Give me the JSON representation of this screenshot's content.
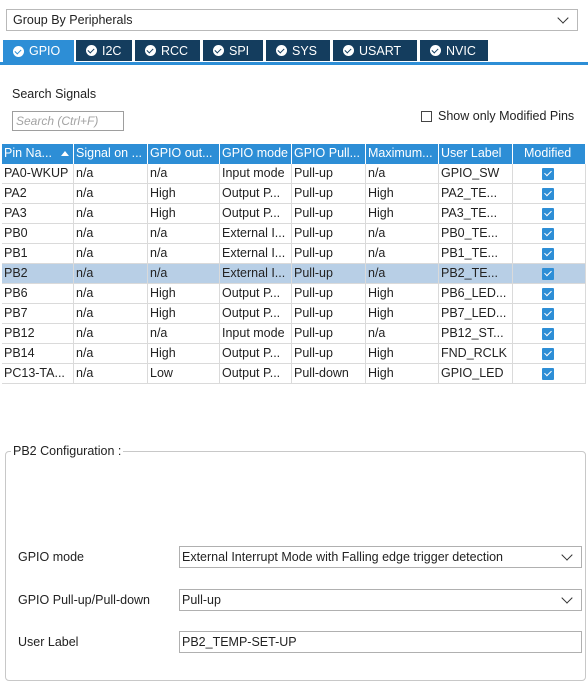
{
  "group_by": {
    "value": "Group By Peripherals"
  },
  "tabs": [
    {
      "label": "GPIO",
      "active": true
    },
    {
      "label": "I2C",
      "active": false
    },
    {
      "label": "RCC",
      "active": false
    },
    {
      "label": "SPI",
      "active": false
    },
    {
      "label": "SYS",
      "active": false
    },
    {
      "label": "USART",
      "active": false
    },
    {
      "label": "NVIC",
      "active": false
    }
  ],
  "search": {
    "label": "Search Signals",
    "placeholder": "Search (Ctrl+F)",
    "show_modified_label": "Show only Modified Pins",
    "show_modified_checked": false
  },
  "table": {
    "columns": [
      "Pin Na...",
      "Signal on ...",
      "GPIO out...",
      "GPIO mode",
      "GPIO Pull...",
      "Maximum...",
      "User Label",
      "Modified"
    ],
    "sort_column": "Pin Na...",
    "rows": [
      {
        "cells": [
          "PA0-WKUP",
          "n/a",
          "n/a",
          "Input mode",
          "Pull-up",
          "n/a",
          "GPIO_SW"
        ],
        "modified": true,
        "selected": false
      },
      {
        "cells": [
          "PA2",
          "n/a",
          "High",
          "Output P...",
          "Pull-up",
          "High",
          "PA2_TE..."
        ],
        "modified": true,
        "selected": false
      },
      {
        "cells": [
          "PA3",
          "n/a",
          "High",
          "Output P...",
          "Pull-up",
          "High",
          "PA3_TE..."
        ],
        "modified": true,
        "selected": false
      },
      {
        "cells": [
          "PB0",
          "n/a",
          "n/a",
          "External I...",
          "Pull-up",
          "n/a",
          "PB0_TE..."
        ],
        "modified": true,
        "selected": false
      },
      {
        "cells": [
          "PB1",
          "n/a",
          "n/a",
          "External I...",
          "Pull-up",
          "n/a",
          "PB1_TE..."
        ],
        "modified": true,
        "selected": false
      },
      {
        "cells": [
          "PB2",
          "n/a",
          "n/a",
          "External I...",
          "Pull-up",
          "n/a",
          "PB2_TE..."
        ],
        "modified": true,
        "selected": true
      },
      {
        "cells": [
          "PB6",
          "n/a",
          "High",
          "Output P...",
          "Pull-up",
          "High",
          "PB6_LED..."
        ],
        "modified": true,
        "selected": false
      },
      {
        "cells": [
          "PB7",
          "n/a",
          "High",
          "Output P...",
          "Pull-up",
          "High",
          "PB7_LED..."
        ],
        "modified": true,
        "selected": false
      },
      {
        "cells": [
          "PB12",
          "n/a",
          "n/a",
          "Input mode",
          "Pull-up",
          "n/a",
          "PB12_ST..."
        ],
        "modified": true,
        "selected": false
      },
      {
        "cells": [
          "PB14",
          "n/a",
          "High",
          "Output P...",
          "Pull-up",
          "High",
          "FND_RCLK"
        ],
        "modified": true,
        "selected": false
      },
      {
        "cells": [
          "PC13-TA...",
          "n/a",
          "Low",
          "Output P...",
          "Pull-down",
          "High",
          "GPIO_LED"
        ],
        "modified": true,
        "selected": false
      }
    ]
  },
  "config": {
    "title": "PB2 Configuration :",
    "gpio_mode_label": "GPIO mode",
    "gpio_mode_value": "External Interrupt Mode with Falling edge trigger detection",
    "pull_label": "GPIO Pull-up/Pull-down",
    "pull_value": "Pull-up",
    "user_label_label": "User Label",
    "user_label_value": "PB2_TEMP-SET-UP"
  },
  "colors": {
    "accent": "#2d8ed6",
    "tab_dark": "#143d5e",
    "selected_row": "#b8cfe6"
  }
}
